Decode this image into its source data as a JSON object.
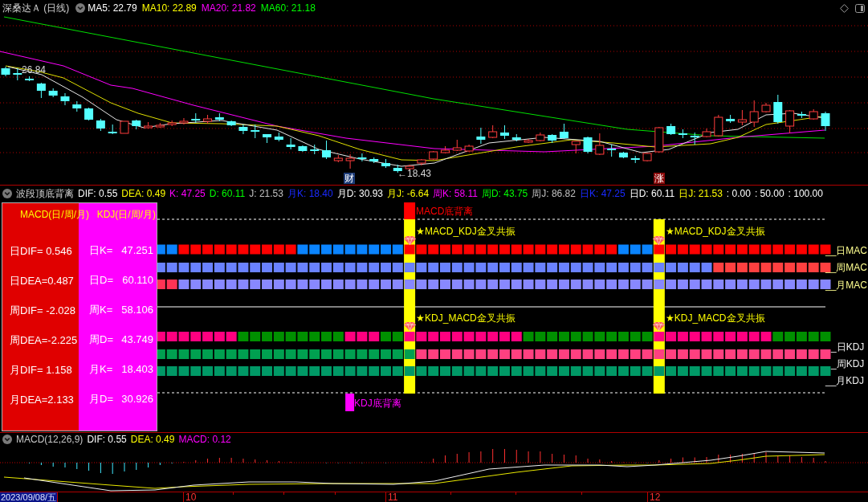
{
  "price_panel": {
    "title": "深桑达Ａ (日线)",
    "indicators": [
      {
        "label": "MA5: 22.79",
        "color": "#ffffff"
      },
      {
        "label": "MA10: 22.89",
        "color": "#ffff00"
      },
      {
        "label": "MA20: 21.82",
        "color": "#ff00ff"
      },
      {
        "label": "MA60: 21.18",
        "color": "#00ff00"
      }
    ],
    "high_label": "26.84",
    "low_label": "←18.43",
    "events": [
      {
        "text": "财",
        "color": "#1e3c78"
      },
      {
        "text": "涨",
        "color": "#8c0a0a"
      }
    ]
  },
  "signal_panel": {
    "title": "波段顶底背离",
    "indicators": [
      {
        "label": "DIF: 0.55",
        "color": "#ffffff"
      },
      {
        "label": "DEA: 0.49",
        "color": "#ffff00"
      },
      {
        "label": "K: 47.25",
        "color": "#ff00ff"
      },
      {
        "label": "D: 60.11",
        "color": "#00ff00"
      },
      {
        "label": "J: 21.53",
        "color": "#c0c0c0"
      },
      {
        "label": "月K: 18.40",
        "color": "#1a2aff"
      },
      {
        "label": "月D: 30.93",
        "color": "#ffffff"
      },
      {
        "label": "月J: -6.64",
        "color": "#ffff00"
      },
      {
        "label": "周K: 58.11",
        "color": "#ff00ff"
      },
      {
        "label": "周D: 43.75",
        "color": "#00ff00"
      },
      {
        "label": "周J: 86.82",
        "color": "#c0c0c0"
      },
      {
        "label": "日K: 47.25",
        "color": "#1a2aff"
      },
      {
        "label": "日D: 60.11",
        "color": "#ffffff"
      },
      {
        "label": "日J: 21.53",
        "color": "#ffff00"
      },
      {
        "label": ": 0.00",
        "color": "#ffffff"
      },
      {
        "label": ": 50.00",
        "color": "#ffffff"
      },
      {
        "label": ": 100.00",
        "color": "#ffffff"
      }
    ],
    "table": {
      "macd_title": "MACD(日/周/月)",
      "kdj_title": "KDJ(日/周/月)",
      "rows": [
        {
          "macd": "日DIF= 0.546",
          "kdj_label": "日K=",
          "kdj_value": "47.251"
        },
        {
          "macd": "日DEA=0.487",
          "kdj_label": "日D=",
          "kdj_value": "60.110"
        },
        {
          "macd": "周DIF= -2.028",
          "kdj_label": "周K=",
          "kdj_value": "58.106"
        },
        {
          "macd": "周DEA=-2.225",
          "kdj_label": "周D=",
          "kdj_value": "43.749"
        },
        {
          "macd": "月DIF= 1.158",
          "kdj_label": "月K=",
          "kdj_value": "18.403"
        },
        {
          "macd": "月DEA=2.133",
          "kdj_label": "月D=",
          "kdj_value": "30.926"
        }
      ]
    },
    "divergences": [
      {
        "kind": "macd",
        "label": "MACD底背离",
        "color": "#ff0000"
      },
      {
        "kind": "kdj",
        "label": "KDJ底背离",
        "color": "#ff00ff"
      }
    ],
    "crossovers": [
      {
        "macd_label": "★MACD_KDJ金叉共振",
        "kdj_label": "★KDJ_MACD金叉共振"
      },
      {
        "macd_label": "★MACD_KDJ金叉共振",
        "kdj_label": "★KDJ_MACD金叉共振"
      }
    ],
    "macd_rows": [
      "__日MAC",
      "__周MAC",
      "__月MAC"
    ],
    "kdj_rows": [
      "_日KDJ",
      "_周KDJ",
      "__月KDJ"
    ]
  },
  "macd_panel": {
    "title": "MACD(12,26,9)",
    "indicators": [
      {
        "label": "DIF: 0.55",
        "color": "#ffffff"
      },
      {
        "label": "DEA: 0.49",
        "color": "#ffff00"
      },
      {
        "label": "MACD: 0.12",
        "color": "#ff00ff"
      }
    ]
  },
  "date_axis": {
    "cursor_date": "2023/09/08/五",
    "months": [
      "10",
      "11",
      "12"
    ]
  }
}
